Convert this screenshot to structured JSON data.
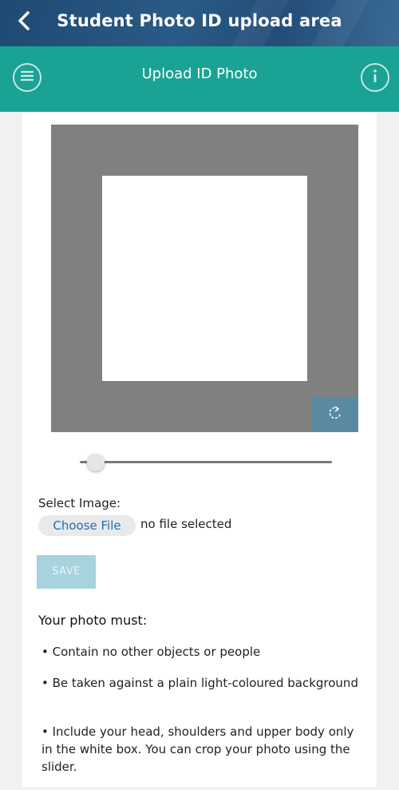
{
  "app_bar": {
    "title": "Student Photo ID upload area",
    "back_icon": "chevron-left-icon"
  },
  "header": {
    "title": "Upload ID Photo",
    "menu_icon": "menu-icon",
    "info_icon": "info-icon"
  },
  "cropper": {
    "rotate_icon": "rotate-icon",
    "zoom_slider_value": 0.03
  },
  "file_select": {
    "label": "Select Image:",
    "button_label": "Choose File",
    "status": "no file selected"
  },
  "save_label": "SAVE",
  "requirements": {
    "heading": "Your photo must:",
    "items": [
      "• Contain no other objects or people",
      "• Be taken against a plain light-coloured background",
      "• Include your head, shoulders and upper body only in the white box. You can crop your photo using the slider."
    ]
  },
  "colors": {
    "app_bar": "#24507c",
    "header": "#1aa394",
    "crop_background": "#808080",
    "rotate_button": "#5a8aa0",
    "save_button": "#a6d3de",
    "link_blue": "#1f6fb0"
  }
}
